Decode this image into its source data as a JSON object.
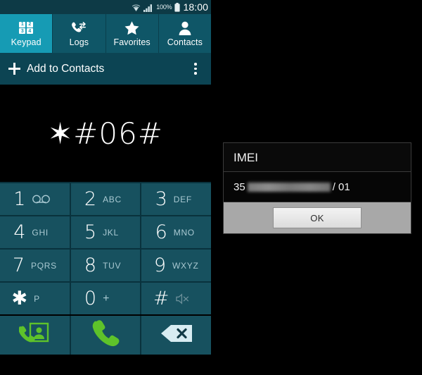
{
  "statusbar": {
    "wifi_icon": "wifi-icon",
    "signal_icon": "signal-bars-icon",
    "battery_percent": "100%",
    "battery_icon": "battery-full-icon",
    "clock": "18:00"
  },
  "tabs": [
    {
      "label": "Keypad",
      "icon": "keypad-grid-icon",
      "active": true,
      "grid": [
        "1",
        "2",
        "3",
        "4"
      ]
    },
    {
      "label": "Logs",
      "icon": "call-logs-icon",
      "active": false
    },
    {
      "label": "Favorites",
      "icon": "star-icon",
      "active": false
    },
    {
      "label": "Contacts",
      "icon": "person-icon",
      "active": false
    }
  ],
  "action_bar": {
    "add_label": "Add to Contacts",
    "plus_icon": "plus-icon",
    "overflow_icon": "overflow-menu-icon"
  },
  "display": {
    "number": "✶#06#"
  },
  "keypad": [
    {
      "digit": "1",
      "sub": "",
      "icon": "voicemail-icon"
    },
    {
      "digit": "2",
      "sub": "ABC",
      "icon": ""
    },
    {
      "digit": "3",
      "sub": "DEF",
      "icon": ""
    },
    {
      "digit": "4",
      "sub": "GHI",
      "icon": ""
    },
    {
      "digit": "5",
      "sub": "JKL",
      "icon": ""
    },
    {
      "digit": "6",
      "sub": "MNO",
      "icon": ""
    },
    {
      "digit": "7",
      "sub": "PQRS",
      "icon": ""
    },
    {
      "digit": "8",
      "sub": "TUV",
      "icon": ""
    },
    {
      "digit": "9",
      "sub": "WXYZ",
      "icon": ""
    },
    {
      "digit": "✱",
      "sub": "P",
      "icon": ""
    },
    {
      "digit": "0",
      "sub": "+",
      "icon": ""
    },
    {
      "digit": "#",
      "sub": "",
      "icon": "silent-mode-icon"
    }
  ],
  "actions": [
    {
      "name": "video-call-button",
      "icon": "call-contact-icon"
    },
    {
      "name": "call-button",
      "icon": "phone-handset-icon"
    },
    {
      "name": "backspace-button",
      "icon": "backspace-icon"
    }
  ],
  "dialog": {
    "title": "IMEI",
    "imei_prefix": "35",
    "imei_redacted": true,
    "imei_suffix": "/ 01",
    "ok_label": "OK"
  },
  "colors": {
    "tab_active": "#169bb4",
    "tab_bar": "#0f5667",
    "action_bar": "#0c4453",
    "statusbar": "#0d3a46",
    "key": "#17515f",
    "key_divider": "#09323d",
    "green_action": "#5ec22a",
    "backspace": "#d8ecf2"
  }
}
